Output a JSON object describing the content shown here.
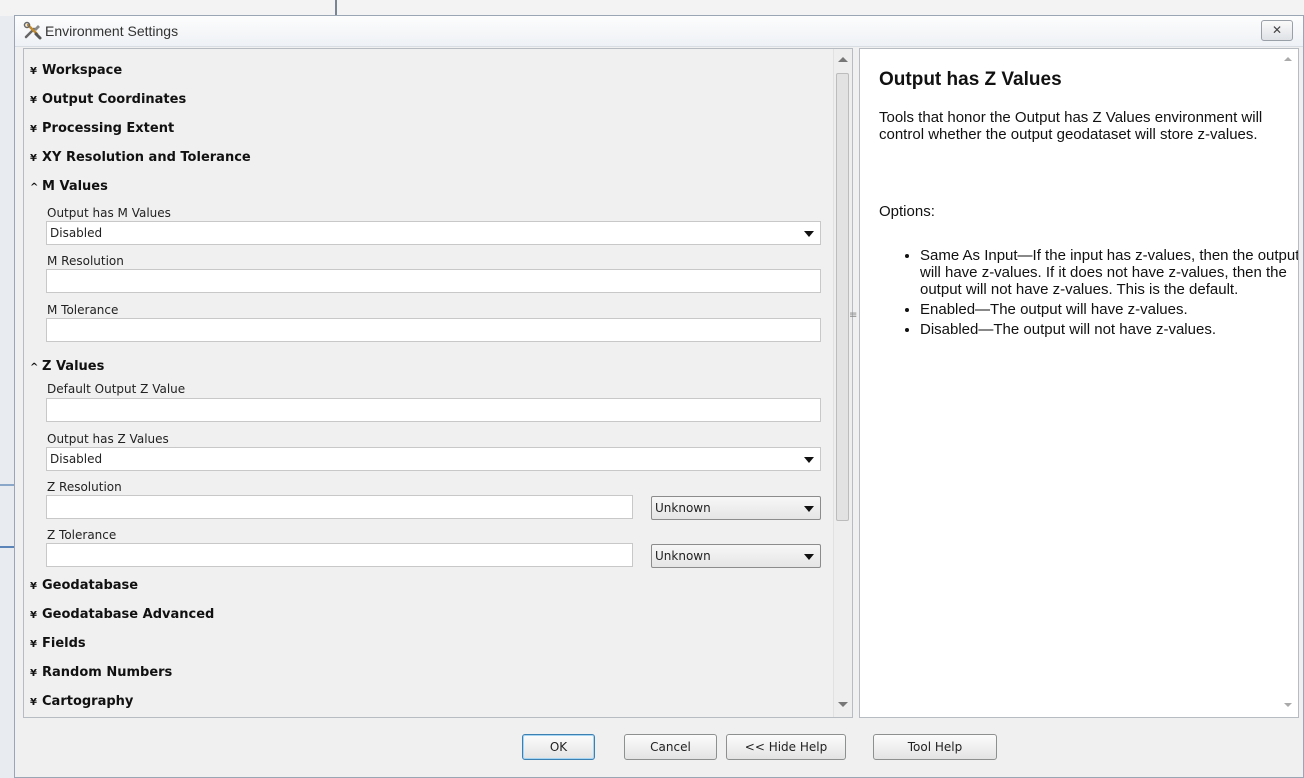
{
  "window": {
    "title": "Environment Settings",
    "close_symbol": "✕"
  },
  "sections": {
    "workspace": "Workspace",
    "output_coordinates": "Output Coordinates",
    "processing_extent": "Processing Extent",
    "xy_resolution": "XY Resolution and Tolerance",
    "m_values": "M Values",
    "z_values": "Z Values",
    "geodatabase": "Geodatabase",
    "geodatabase_advanced": "Geodatabase Advanced",
    "fields": "Fields",
    "random_numbers": "Random Numbers",
    "cartography": "Cartography"
  },
  "chevrons": {
    "collapsed": "¥",
    "expanded": "^"
  },
  "m_values": {
    "output_has_m_label": "Output has M Values",
    "output_has_m_value": "Disabled",
    "m_resolution_label": "M Resolution",
    "m_resolution_value": "",
    "m_tolerance_label": "M Tolerance",
    "m_tolerance_value": ""
  },
  "z_values": {
    "default_output_z_label": "Default Output Z Value",
    "default_output_z_value": "",
    "output_has_z_label": "Output has Z Values",
    "output_has_z_value": "Disabled",
    "z_resolution_label": "Z Resolution",
    "z_resolution_value": "",
    "z_resolution_unit": "Unknown",
    "z_tolerance_label": "Z Tolerance",
    "z_tolerance_value": "",
    "z_tolerance_unit": "Unknown"
  },
  "help": {
    "title": "Output has Z Values",
    "body": "Tools that honor the Output has Z Values environment will control whether the output geodataset will store z-values.",
    "options_label": "Options:",
    "options": [
      "Same As Input—If the input has z-values, then the output will have z-values. If it does not have z-values, then the output will not have z-values. This is the default.",
      "Enabled—The output will have z-values.",
      "Disabled—The output will not have z-values."
    ]
  },
  "buttons": {
    "ok": "OK",
    "cancel": "Cancel",
    "hide_help": "<< Hide Help",
    "tool_help": "Tool Help"
  },
  "splitter_glyph": "≡"
}
